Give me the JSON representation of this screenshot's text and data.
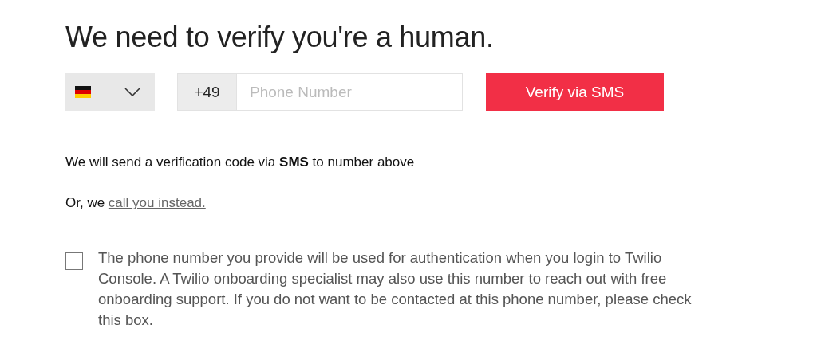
{
  "title": "We need to verify you're a human.",
  "phone": {
    "prefix": "+49",
    "placeholder": "Phone Number"
  },
  "verify_button": "Verify via SMS",
  "info": "We will send a verification code via **SMS** to number above",
  "call": {
    "text": "Or, we",
    "link": "call you instead."
  },
  "consent": {
    "checked": false,
    "text": "The phone number you provide will be used for authentication when you login to Twilio Console. A Twilio onboarding specialist may also use this number to reach out with free onboarding support. If you do not want to be contacted at this phone number, please check this box."
  }
}
